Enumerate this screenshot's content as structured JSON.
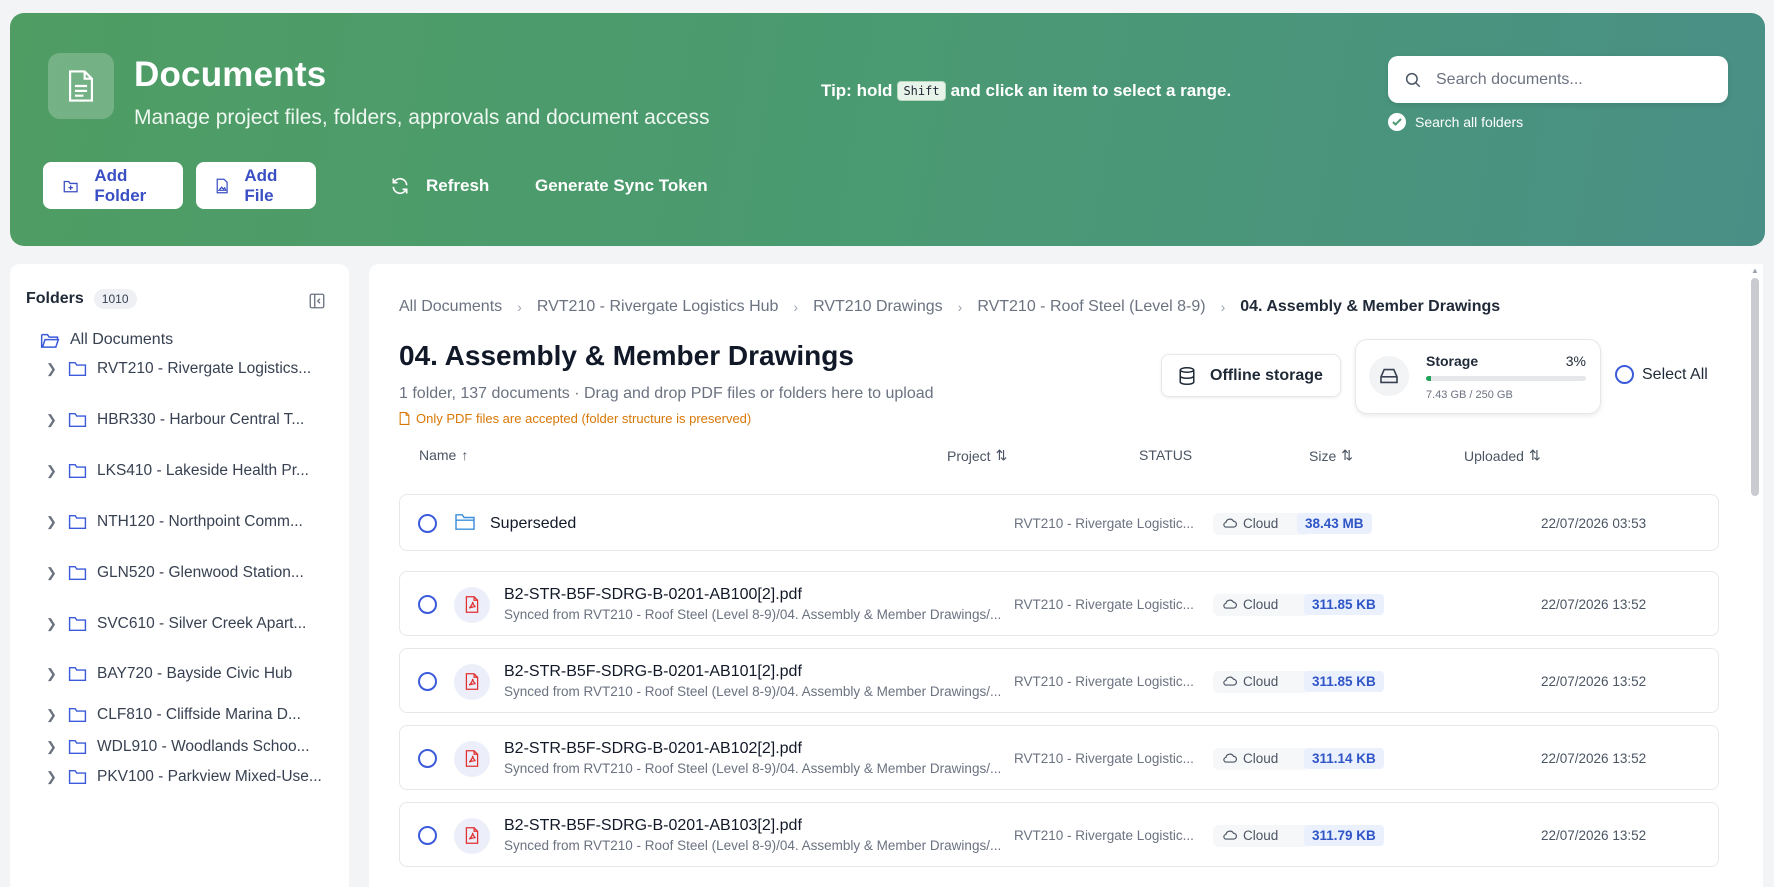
{
  "header": {
    "title": "Documents",
    "subtitle": "Manage project files, folders, approvals and document access",
    "tip_prefix": "Tip: hold",
    "tip_key": "Shift",
    "tip_suffix": "and click an item to select a range.",
    "search_placeholder": "Search documents...",
    "search_all_label": "Search all folders",
    "add_folder": "Add Folder",
    "add_file": "Add File",
    "refresh": "Refresh",
    "sync_token": "Generate Sync Token"
  },
  "sidebar": {
    "title": "Folders",
    "count": "1010",
    "all_label": "All Documents",
    "items": [
      {
        "label": "RVT210 - Rivergate Logistics..."
      },
      {
        "label": "HBR330 - Harbour Central T..."
      },
      {
        "label": "LKS410 - Lakeside Health Pr..."
      },
      {
        "label": "NTH120 - Northpoint Comm..."
      },
      {
        "label": "GLN520 - Glenwood Station..."
      },
      {
        "label": "SVC610 - Silver Creek Apart..."
      },
      {
        "label": "BAY720 - Bayside Civic Hub"
      },
      {
        "label": "CLF810 - Cliffside Marina D..."
      },
      {
        "label": "WDL910 - Woodlands Schoo..."
      },
      {
        "label": "PKV100 - Parkview Mixed-Use..."
      }
    ]
  },
  "breadcrumb": {
    "items": [
      "All Documents",
      "RVT210 - Rivergate Logistics Hub",
      "RVT210 Drawings",
      "RVT210 - Roof Steel (Level 8-9)"
    ],
    "current": "04. Assembly & Member Drawings"
  },
  "folder": {
    "title": "04. Assembly & Member Drawings",
    "summary": "1 folder, 137 documents · Drag and drop PDF files or folders here to upload",
    "warning": "Only PDF files are accepted (folder structure is preserved)"
  },
  "offline_label": "Offline storage",
  "storage": {
    "label": "Storage",
    "percent": "3%",
    "fraction": 0.03,
    "used_text": "7.43 GB / 250 GB"
  },
  "select_all": "Select All",
  "columns": {
    "name": "Name",
    "project": "Project",
    "status": "STATUS",
    "size": "Size",
    "uploaded": "Uploaded"
  },
  "rows": [
    {
      "name": "Superseded",
      "sync": "",
      "project": "RVT210 - Rivergate Logistic...",
      "status": "Cloud",
      "size": "38.43 MB",
      "uploaded": "22/07/2026 03:53"
    },
    {
      "name": "B2-STR-B5F-SDRG-B-0201-AB100[2].pdf",
      "sync": "Synced from RVT210 - Roof Steel (Level 8-9)/04. Assembly & Member Drawings/...",
      "project": "RVT210 - Rivergate Logistic...",
      "status": "Cloud",
      "size": "311.85 KB",
      "uploaded": "22/07/2026 13:52"
    },
    {
      "name": "B2-STR-B5F-SDRG-B-0201-AB101[2].pdf",
      "sync": "Synced from RVT210 - Roof Steel (Level 8-9)/04. Assembly & Member Drawings/...",
      "project": "RVT210 - Rivergate Logistic...",
      "status": "Cloud",
      "size": "311.85 KB",
      "uploaded": "22/07/2026 13:52"
    },
    {
      "name": "B2-STR-B5F-SDRG-B-0201-AB102[2].pdf",
      "sync": "Synced from RVT210 - Roof Steel (Level 8-9)/04. Assembly & Member Drawings/...",
      "project": "RVT210 - Rivergate Logistic...",
      "status": "Cloud",
      "size": "311.14 KB",
      "uploaded": "22/07/2026 13:52"
    },
    {
      "name": "B2-STR-B5F-SDRG-B-0201-AB103[2].pdf",
      "sync": "Synced from RVT210 - Roof Steel (Level 8-9)/04. Assembly & Member Drawings/...",
      "project": "RVT210 - Rivergate Logistic...",
      "status": "Cloud",
      "size": "311.79 KB",
      "uploaded": "22/07/2026 13:52"
    }
  ],
  "colors": {
    "accent": "#3b4fc4",
    "header_start": "#4f9d63",
    "header_end": "#4a8f86",
    "warning": "#d97706"
  }
}
